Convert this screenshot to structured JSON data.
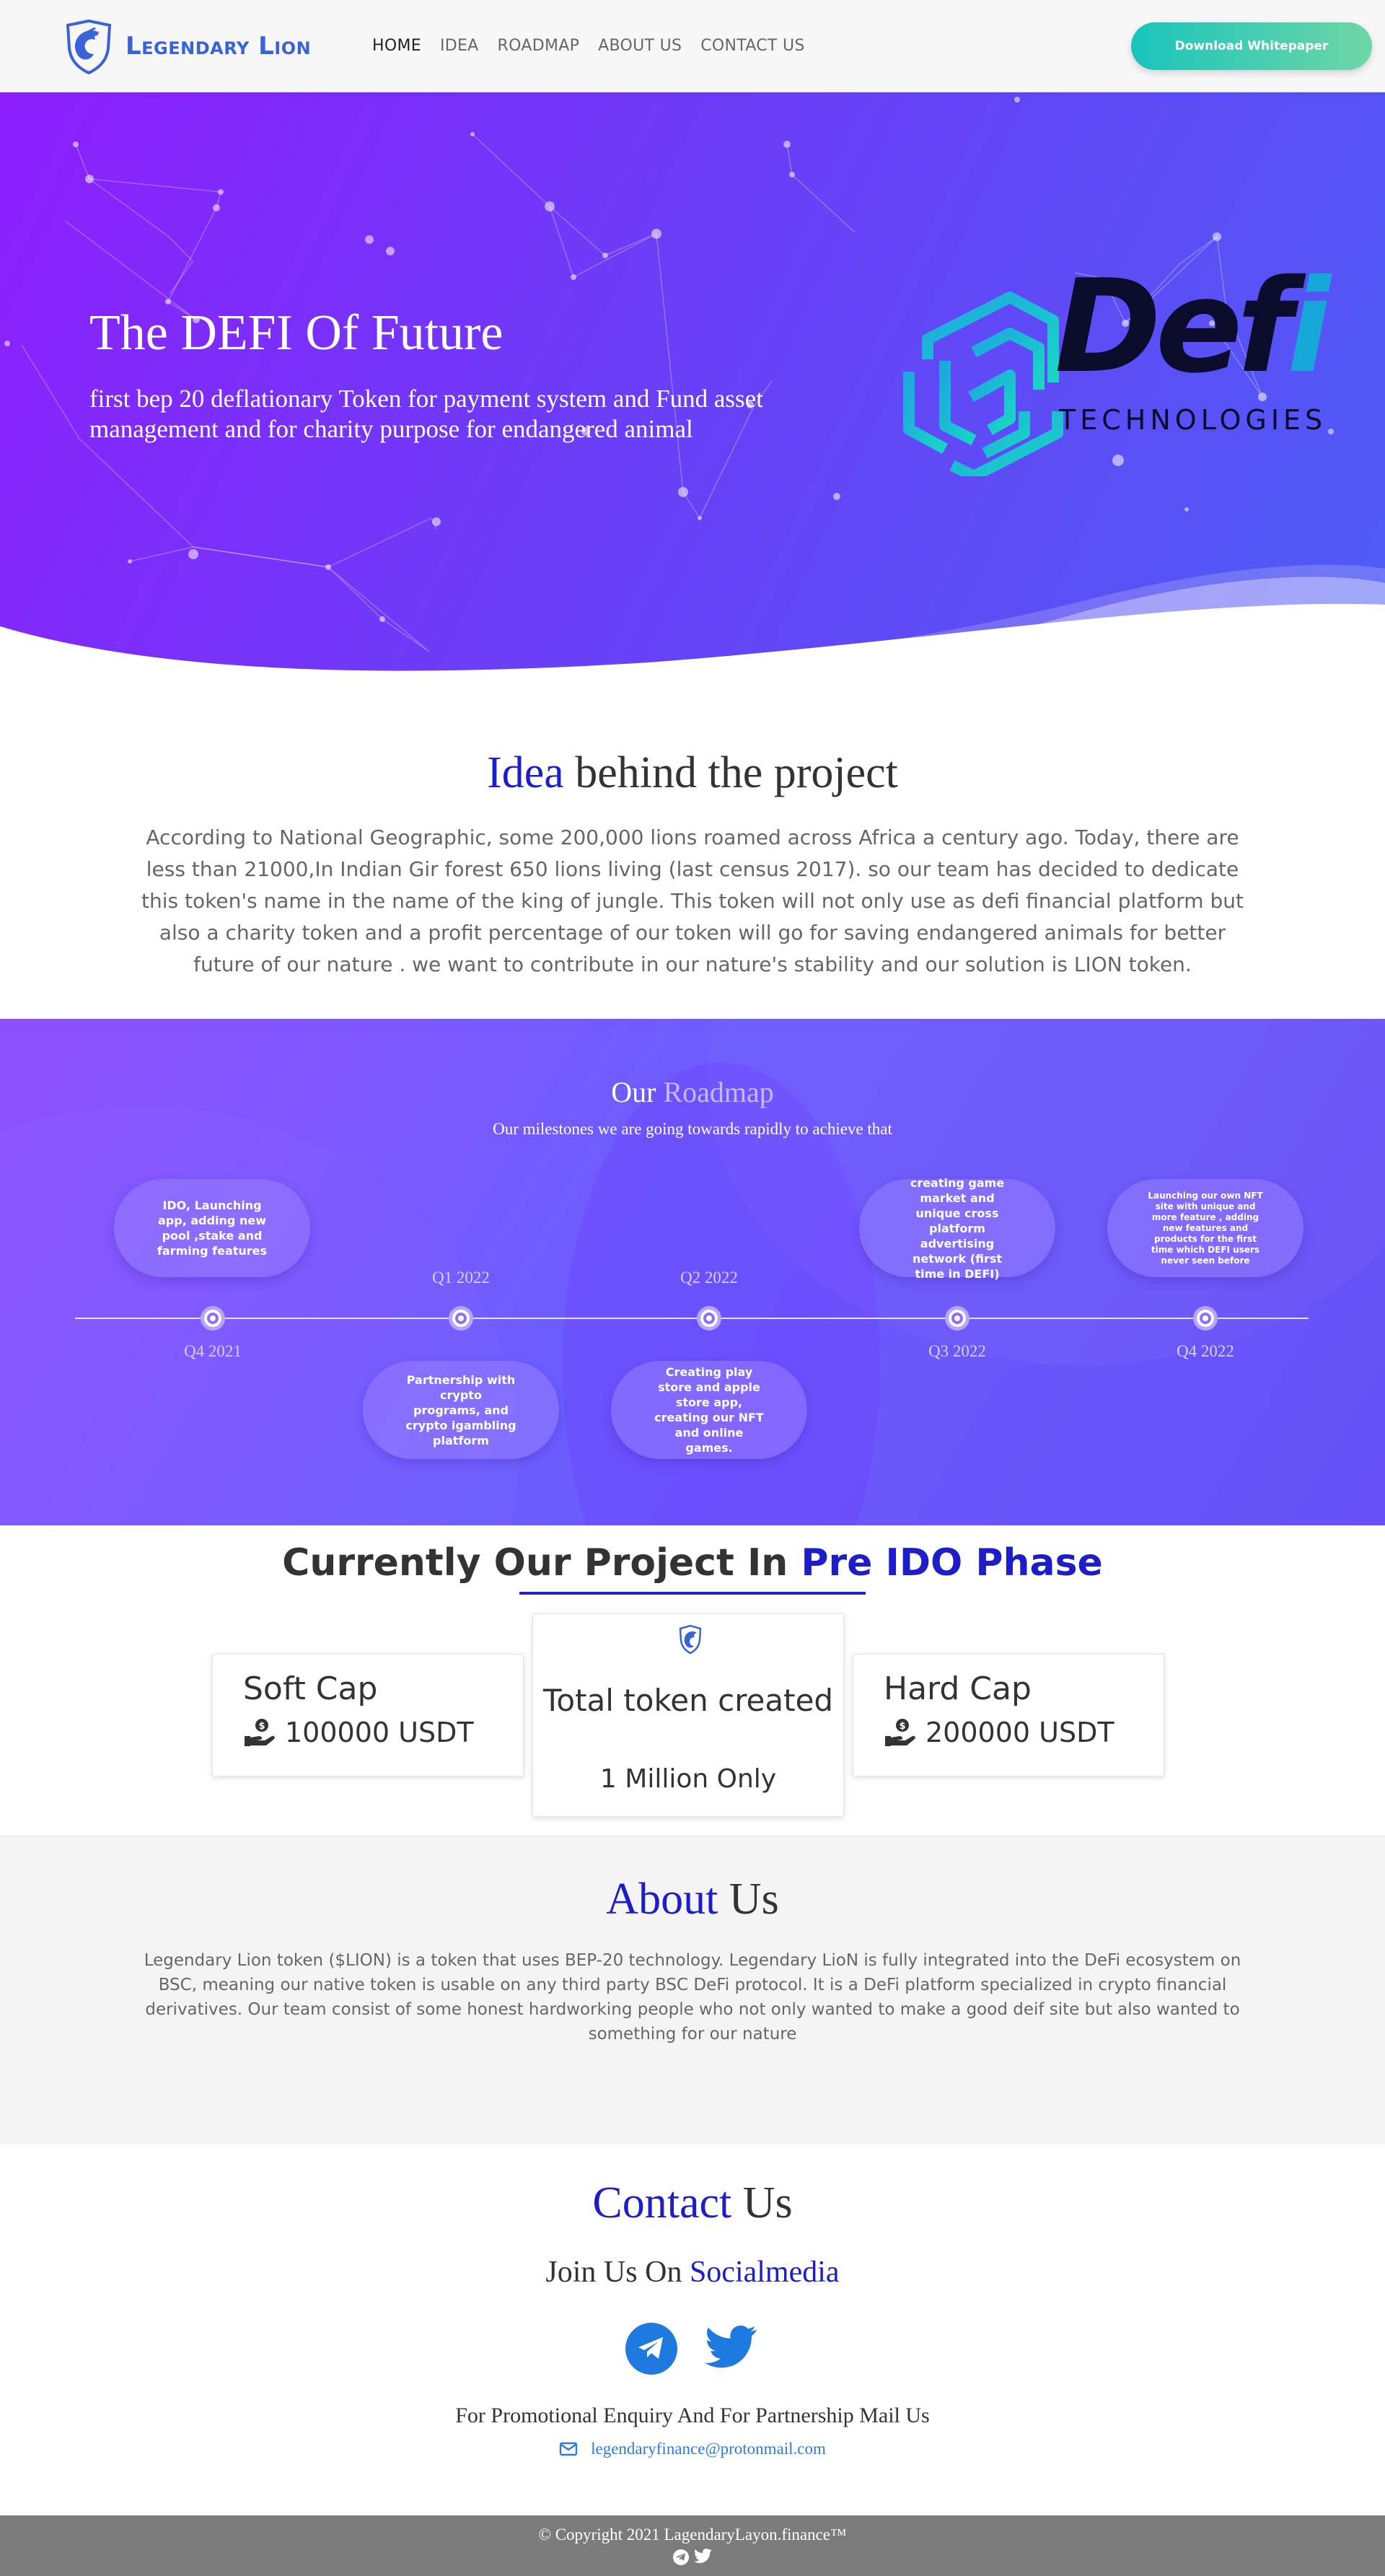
{
  "nav": {
    "brand": "Legendary Lion",
    "links": [
      "HOME",
      "IDEA",
      "ROADMAP",
      "ABOUT US",
      "CONTACT US"
    ],
    "whitepaper_button": "Download Whitepaper"
  },
  "hero": {
    "title": "The DEFI Of Future",
    "subtitle": "first bep 20 deflationary Token for payment system and Fund asset management and for charity purpose for endangered animal",
    "logo_word_main": "Def",
    "logo_word_end": "i",
    "logo_tagline": "TECHNOLOGIES"
  },
  "idea": {
    "title_accent": "Idea",
    "title_rest": " behind the project",
    "text": "According to National Geographic, some 200,000 lions roamed across Africa a century ago. Today, there are less than 21000,In Indian Gir forest 650 lions living (last census 2017). so our team has decided to dedicate this token's name in the name of the king of jungle. This token will not only use as defi financial platform but also a charity token and a profit percentage of our token will go for saving endangered animals for better future of our nature . we want to contribute in our nature's stability and our solution is LION token."
  },
  "roadmap": {
    "title_main": "Our ",
    "title_light": "Roadmap",
    "subtitle": "Our milestones we are going towards rapidly to achieve that",
    "milestones": [
      {
        "label": "Q4 2021",
        "text": "IDO, Launching app, adding new pool ,stake and farming features"
      },
      {
        "label": "Q1 2022",
        "text": "Partnership with crypto programs, and crypto igambling platform"
      },
      {
        "label": "Q2 2022",
        "text": "Creating play store and apple store app, creating our NFT and online games."
      },
      {
        "label": "Q3 2022",
        "text": "creating game market and unique cross platform advertising network (first time in DEFI)"
      },
      {
        "label": "Q4 2022",
        "text": "Launching our own NFT site with unique and more feature , adding new features and products for the first time which DEFI users never seen before"
      }
    ]
  },
  "ido": {
    "title_pre": "Currently Our Project In ",
    "title_accent": "Pre IDO Phase",
    "soft_cap_title": "Soft Cap",
    "soft_cap_value": "100000 USDT",
    "total_title": "Total token created",
    "total_value": "1 Million Only",
    "hard_cap_title": "Hard Cap",
    "hard_cap_value": "200000 USDT"
  },
  "about": {
    "title_accent": "About",
    "title_rest": " Us",
    "text": "Legendary Lion token ($LION) is a token that uses BEP-20 technology. Legendary LioN is fully integrated into the DeFi ecosystem on BSC, meaning our native token is usable on any third party BSC DeFi protocol. It is a DeFi platform specialized in crypto financial derivatives. Our team consist of some honest hardworking people who not only wanted to make a good deif site but also wanted to something for our nature"
  },
  "contact": {
    "title_accent": "Contact",
    "title_rest": " Us",
    "join_pre": "Join Us On ",
    "join_accent": "Socialmedia",
    "promo": "For Promotional Enquiry And For Partnership Mail Us",
    "email": "legendaryfinance@protonmail.com"
  },
  "footer": {
    "copyright": "© Copyright 2021 LagendaryLayon.finance™"
  },
  "colors": {
    "accent_blue": "#1d1dc9",
    "hero_start": "#8d1efd",
    "hero_end": "#4e5cf5",
    "button_start": "#19c4bd",
    "button_end": "#6fd6a6",
    "link_blue": "#2a7be4",
    "footer_gray": "#7b7b7b"
  },
  "icons": [
    "lion-shield-logo",
    "defi-hex-logo",
    "hand-coin-icon",
    "telegram-icon",
    "twitter-icon",
    "envelope-icon"
  ]
}
